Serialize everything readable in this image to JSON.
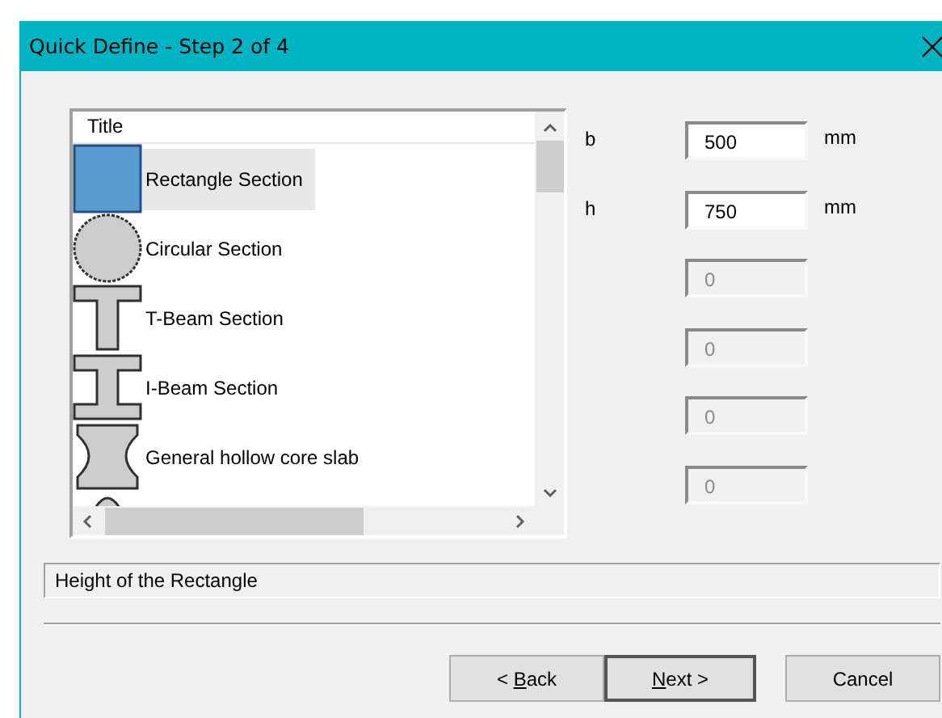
{
  "window": {
    "title": "Quick Define - Step 2 of 4"
  },
  "list": {
    "header": "Title",
    "items": [
      {
        "kind": "rectangle",
        "label": "Rectangle Section",
        "selected": true
      },
      {
        "kind": "circle",
        "label": "Circular Section",
        "selected": false
      },
      {
        "kind": "tbeam",
        "label": "T-Beam Section",
        "selected": false
      },
      {
        "kind": "ibeam",
        "label": "I-Beam Section",
        "selected": false
      },
      {
        "kind": "hollow",
        "label": "General hollow core slab",
        "selected": false
      },
      {
        "kind": "dome",
        "selected": false
      }
    ]
  },
  "fields": [
    {
      "label": "b",
      "value": "500",
      "unit": "mm",
      "disabled": false
    },
    {
      "label": "h",
      "value": "750",
      "unit": "mm",
      "disabled": false
    },
    {
      "value": "0",
      "disabled": true
    },
    {
      "value": "0",
      "disabled": true
    },
    {
      "value": "0",
      "disabled": true
    },
    {
      "value": "0",
      "disabled": true
    }
  ],
  "status": "Height of the Rectangle",
  "buttons": [
    {
      "label_before": "< ",
      "access_key": "B",
      "label_after": "ack",
      "default": false
    },
    {
      "access_key": "N",
      "label_after": "ext >",
      "default": true
    },
    {
      "label": "Cancel",
      "default": false
    }
  ]
}
